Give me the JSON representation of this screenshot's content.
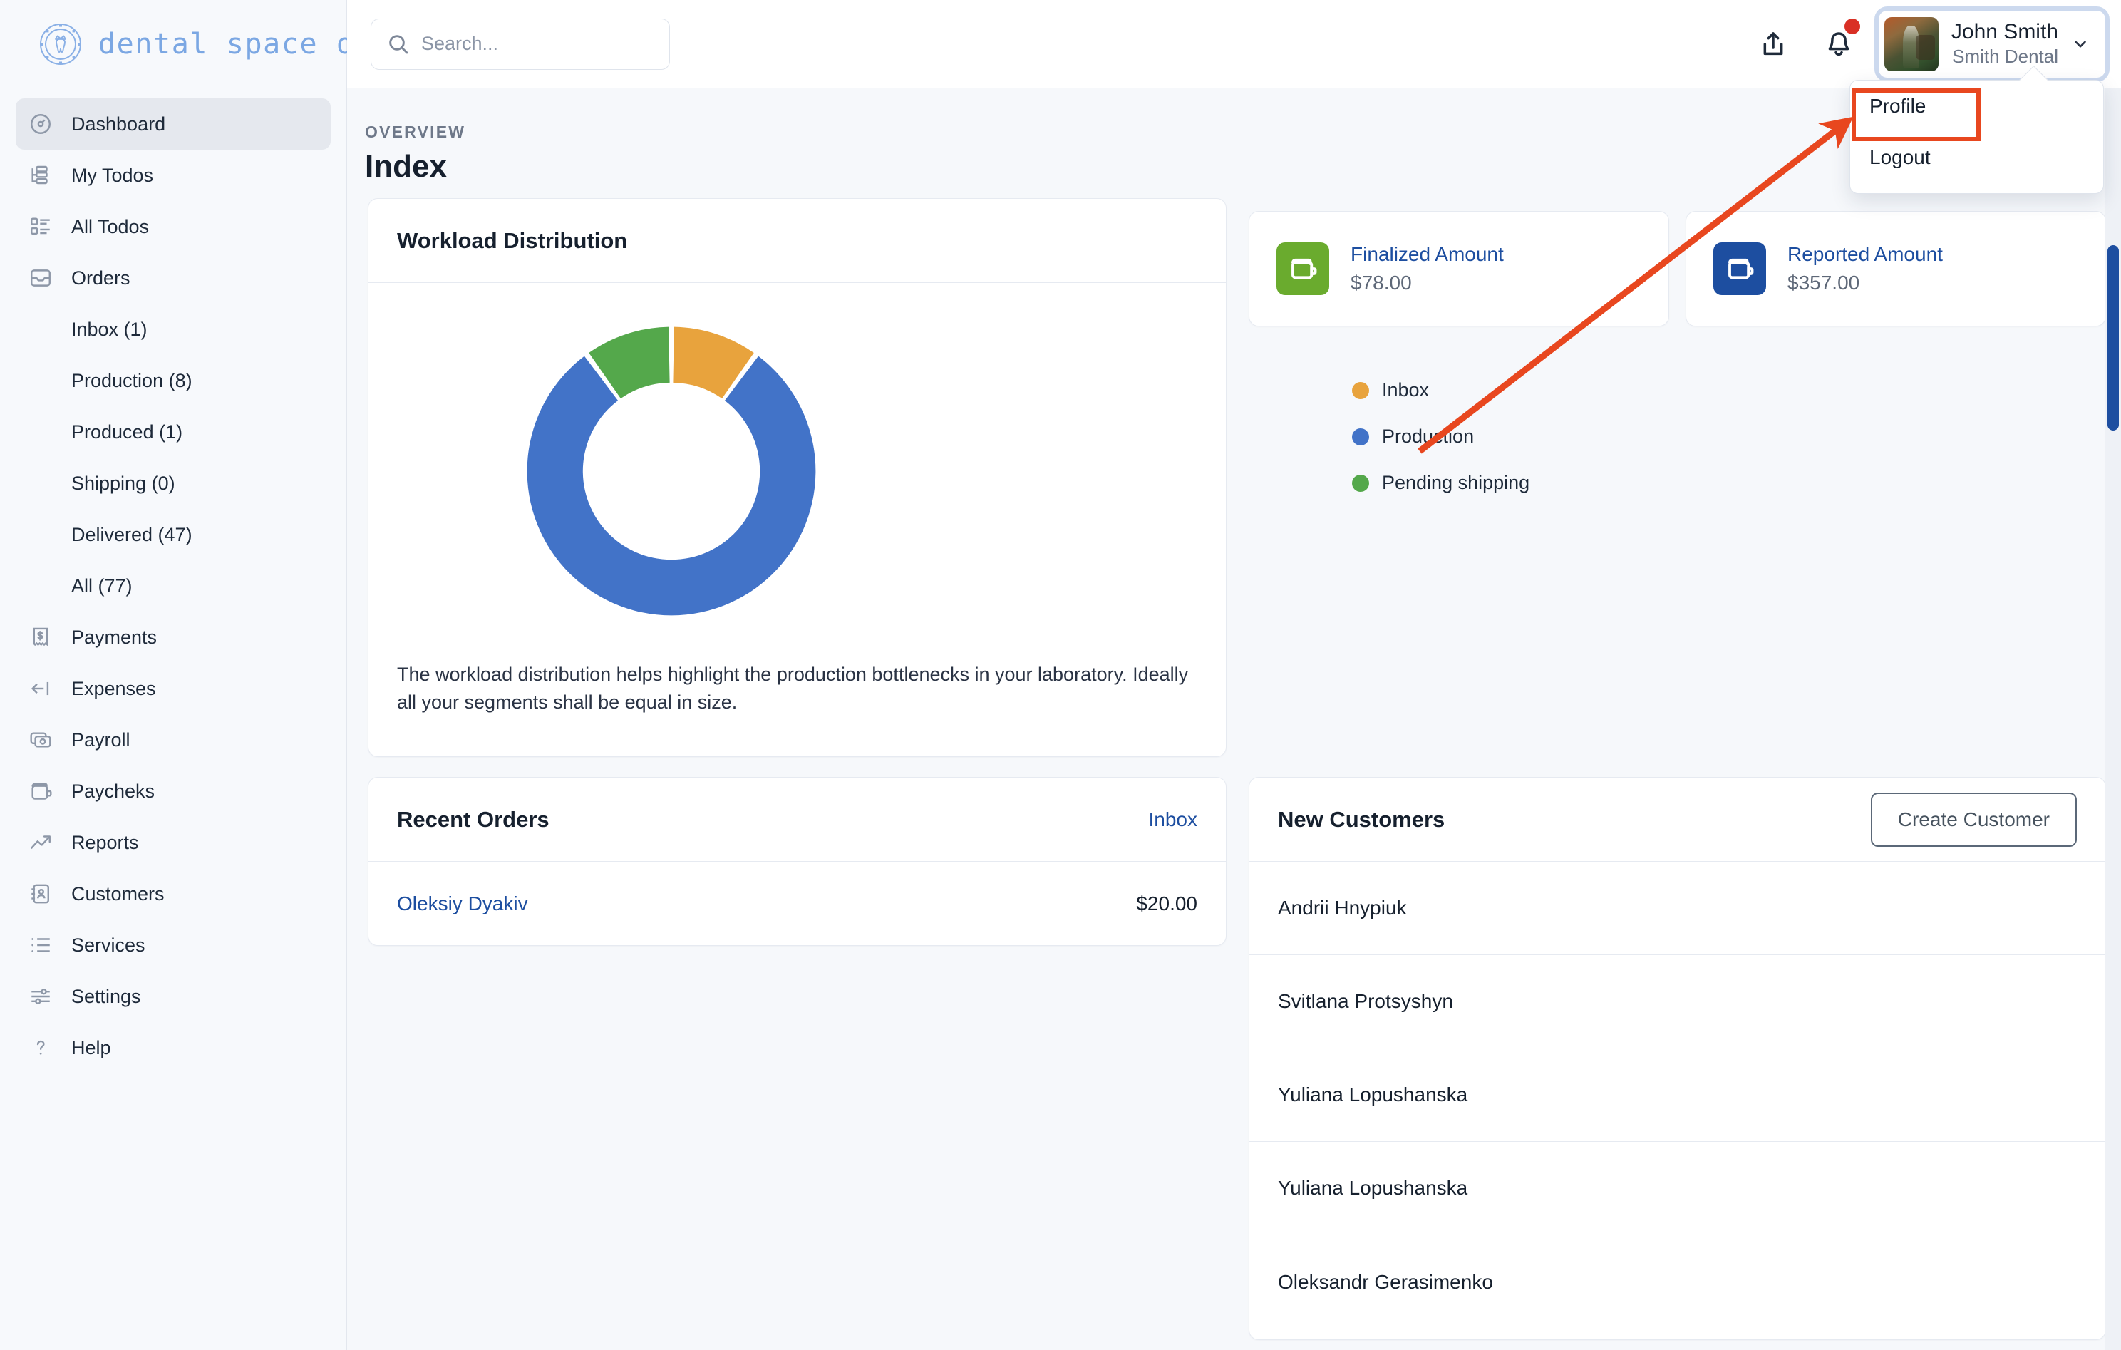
{
  "brand": {
    "name": "dental space one",
    "logo_icon": "tooth-crown-emblem-icon"
  },
  "search": {
    "placeholder": "Search...",
    "value": "",
    "icon": "search-icon"
  },
  "header": {
    "share_icon": "share-icon",
    "bell_icon": "bell-icon",
    "notification_dot": true,
    "user": {
      "name": "John Smith",
      "org": "Smith Dental",
      "chevron_icon": "chevron-down-icon",
      "avatar_icon": "user-avatar"
    }
  },
  "dropdown": {
    "items": [
      {
        "label": "Profile",
        "highlighted": true
      },
      {
        "label": "Logout",
        "highlighted": false
      }
    ]
  },
  "sidebar": {
    "items": [
      {
        "label": "Dashboard",
        "icon": "gauge-icon",
        "active": true,
        "sub": false
      },
      {
        "label": "My Todos",
        "icon": "tree-list-icon",
        "active": false,
        "sub": false
      },
      {
        "label": "All Todos",
        "icon": "checklist-icon",
        "active": false,
        "sub": false
      },
      {
        "label": "Orders",
        "icon": "inbox-icon",
        "active": false,
        "sub": false
      },
      {
        "label": "Inbox (1)",
        "icon": "",
        "active": false,
        "sub": true
      },
      {
        "label": "Production (8)",
        "icon": "",
        "active": false,
        "sub": true
      },
      {
        "label": "Produced (1)",
        "icon": "",
        "active": false,
        "sub": true
      },
      {
        "label": "Shipping (0)",
        "icon": "",
        "active": false,
        "sub": true
      },
      {
        "label": "Delivered (47)",
        "icon": "",
        "active": false,
        "sub": true
      },
      {
        "label": "All (77)",
        "icon": "",
        "active": false,
        "sub": true
      },
      {
        "label": "Payments",
        "icon": "receipt-dollar-icon",
        "active": false,
        "sub": false
      },
      {
        "label": "Expenses",
        "icon": "arrow-left-bar-icon",
        "active": false,
        "sub": false
      },
      {
        "label": "Payroll",
        "icon": "money-stack-icon",
        "active": false,
        "sub": false
      },
      {
        "label": "Paycheks",
        "icon": "wallet-icon",
        "active": false,
        "sub": false
      },
      {
        "label": "Reports",
        "icon": "trend-up-icon",
        "active": false,
        "sub": false
      },
      {
        "label": "Customers",
        "icon": "contact-book-icon",
        "active": false,
        "sub": false
      },
      {
        "label": "Services",
        "icon": "list-icon",
        "active": false,
        "sub": false
      },
      {
        "label": "Settings",
        "icon": "sliders-icon",
        "active": false,
        "sub": false
      },
      {
        "label": "Help",
        "icon": "question-mark-icon",
        "active": false,
        "sub": false
      }
    ]
  },
  "page": {
    "eyebrow": "OVERVIEW",
    "title": "Index"
  },
  "chart_card": {
    "title": "Workload Distribution",
    "note": "The workload distribution helps highlight the production bottlenecks in your laboratory. Ideally all your segments shall be equal in size."
  },
  "chart_data": {
    "type": "pie",
    "title": "Workload Distribution",
    "donut": true,
    "categories": [
      "Inbox",
      "Production",
      "Pending shipping"
    ],
    "values": [
      1,
      8,
      1
    ],
    "percentages": [
      10,
      80,
      10
    ],
    "colors": [
      "#e8a33d",
      "#4273c8",
      "#54a84b"
    ],
    "legend_position": "right",
    "start_angle_deg": 0,
    "direction": "clockwise"
  },
  "stats": [
    {
      "title": "Finalized Amount",
      "value": "$78.00",
      "icon": "wallet-icon",
      "color": "#6aab2e"
    },
    {
      "title": "Reported Amount",
      "value": "$357.00",
      "icon": "wallet-icon",
      "color": "#1d4ea0"
    }
  ],
  "recent_orders": {
    "title": "Recent Orders",
    "action_label": "Inbox",
    "rows": [
      {
        "name": "Oleksiy Dyakiv",
        "amount": "$20.00"
      }
    ]
  },
  "new_customers": {
    "title": "New Customers",
    "button_label": "Create Customer",
    "rows": [
      {
        "name": "Andrii Hnypiuk"
      },
      {
        "name": "Svitlana Protsyshyn"
      },
      {
        "name": "Yuliana Lopushanska"
      },
      {
        "name": "Yuliana Lopushanska"
      },
      {
        "name": "Oleksandr Gerasimenko"
      }
    ]
  },
  "annotation": {
    "arrow_color": "#e8471f",
    "highlight_target": "Profile"
  }
}
